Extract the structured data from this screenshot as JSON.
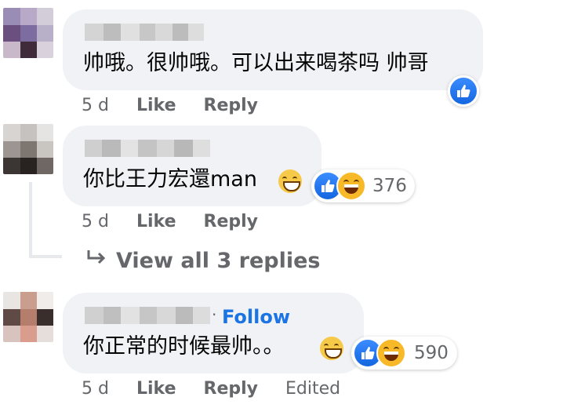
{
  "comments": [
    {
      "text": "帅哦。很帅哦。可以出来喝茶吗 帅哥",
      "time": "5 d",
      "like_label": "Like",
      "reply_label": "Reply",
      "reaction": "like-icon"
    },
    {
      "text": "你比王力宏還man",
      "inline_emoji": "grinning-squinting-face",
      "time": "5 d",
      "like_label": "Like",
      "reply_label": "Reply",
      "reaction_count": "376",
      "view_replies": "View all 3 replies"
    },
    {
      "text": "你正常的时候最帅。。",
      "inline_emoji": "face-with-tears-of-joy",
      "follow_label": "Follow",
      "time": "5 d",
      "like_label": "Like",
      "reply_label": "Reply",
      "edited_label": "Edited",
      "reaction_count": "590"
    }
  ],
  "colors": {
    "bubble": "#f0f2f5",
    "meta_text": "#65676b",
    "link_blue": "#1b74e4",
    "like_blue": "#1877f2",
    "haha_yellow": "#f7b928"
  }
}
